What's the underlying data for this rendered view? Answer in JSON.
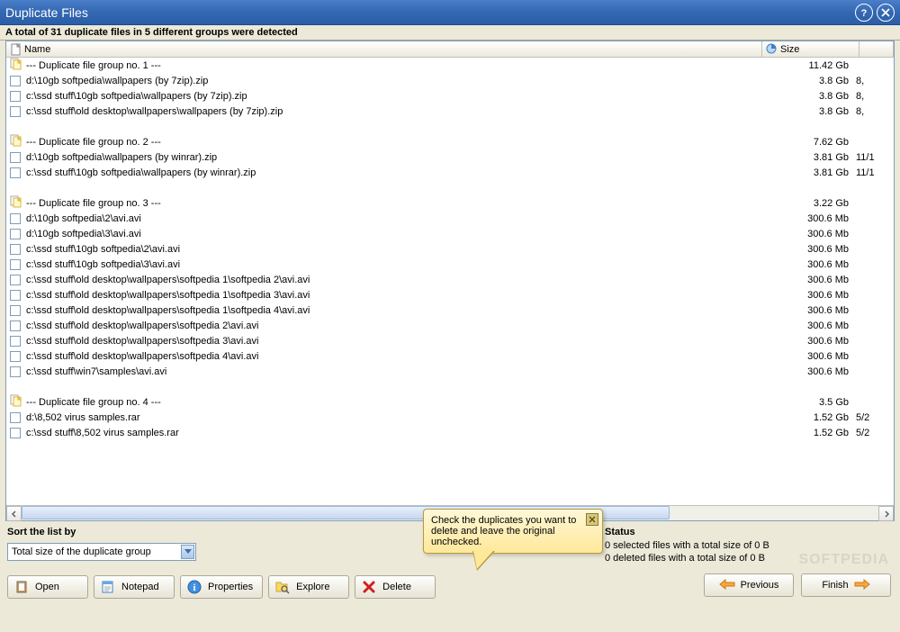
{
  "title": "Duplicate Files",
  "summary": "A total of 31 duplicate files in 5 different groups were detected",
  "columns": {
    "name": "Name",
    "size": "Size"
  },
  "rows": [
    {
      "type": "group",
      "name": "--- Duplicate file group no. 1 ---",
      "size": "11.42 Gb",
      "date": ""
    },
    {
      "type": "file",
      "name": "d:\\10gb softpedia\\wallpapers (by 7zip).zip",
      "size": "3.8 Gb",
      "date": "8,"
    },
    {
      "type": "file",
      "name": "c:\\ssd stuff\\10gb softpedia\\wallpapers (by 7zip).zip",
      "size": "3.8 Gb",
      "date": "8,"
    },
    {
      "type": "file",
      "name": "c:\\ssd stuff\\old desktop\\wallpapers\\wallpapers (by 7zip).zip",
      "size": "3.8 Gb",
      "date": "8,"
    },
    {
      "type": "spacer"
    },
    {
      "type": "group",
      "name": "--- Duplicate file group no. 2 ---",
      "size": "7.62 Gb",
      "date": ""
    },
    {
      "type": "file",
      "name": "d:\\10gb softpedia\\wallpapers (by winrar).zip",
      "size": "3.81 Gb",
      "date": "11/1"
    },
    {
      "type": "file",
      "name": "c:\\ssd stuff\\10gb softpedia\\wallpapers (by winrar).zip",
      "size": "3.81 Gb",
      "date": "11/1"
    },
    {
      "type": "spacer"
    },
    {
      "type": "group",
      "name": "--- Duplicate file group no. 3 ---",
      "size": "3.22 Gb",
      "date": ""
    },
    {
      "type": "file",
      "name": "d:\\10gb softpedia\\2\\avi.avi",
      "size": "300.6 Mb",
      "date": ""
    },
    {
      "type": "file",
      "name": "d:\\10gb softpedia\\3\\avi.avi",
      "size": "300.6 Mb",
      "date": ""
    },
    {
      "type": "file",
      "name": "c:\\ssd stuff\\10gb softpedia\\2\\avi.avi",
      "size": "300.6 Mb",
      "date": ""
    },
    {
      "type": "file",
      "name": "c:\\ssd stuff\\10gb softpedia\\3\\avi.avi",
      "size": "300.6 Mb",
      "date": ""
    },
    {
      "type": "file",
      "name": "c:\\ssd stuff\\old desktop\\wallpapers\\softpedia 1\\softpedia 2\\avi.avi",
      "size": "300.6 Mb",
      "date": ""
    },
    {
      "type": "file",
      "name": "c:\\ssd stuff\\old desktop\\wallpapers\\softpedia 1\\softpedia 3\\avi.avi",
      "size": "300.6 Mb",
      "date": ""
    },
    {
      "type": "file",
      "name": "c:\\ssd stuff\\old desktop\\wallpapers\\softpedia 1\\softpedia 4\\avi.avi",
      "size": "300.6 Mb",
      "date": ""
    },
    {
      "type": "file",
      "name": "c:\\ssd stuff\\old desktop\\wallpapers\\softpedia 2\\avi.avi",
      "size": "300.6 Mb",
      "date": ""
    },
    {
      "type": "file",
      "name": "c:\\ssd stuff\\old desktop\\wallpapers\\softpedia 3\\avi.avi",
      "size": "300.6 Mb",
      "date": ""
    },
    {
      "type": "file",
      "name": "c:\\ssd stuff\\old desktop\\wallpapers\\softpedia 4\\avi.avi",
      "size": "300.6 Mb",
      "date": ""
    },
    {
      "type": "file",
      "name": "c:\\ssd stuff\\win7\\samples\\avi.avi",
      "size": "300.6 Mb",
      "date": ""
    },
    {
      "type": "spacer"
    },
    {
      "type": "group",
      "name": "--- Duplicate file group no. 4 ---",
      "size": "3.5 Gb",
      "date": ""
    },
    {
      "type": "file",
      "name": "d:\\8,502 virus samples.rar",
      "size": "1.52 Gb",
      "date": "5/2"
    },
    {
      "type": "file",
      "name": "c:\\ssd stuff\\8,502 virus samples.rar",
      "size": "1.52 Gb",
      "date": "5/2"
    }
  ],
  "sort": {
    "label": "Sort the list by",
    "selected": "Total size of the duplicate group"
  },
  "status": {
    "label": "Status",
    "line1": "0 selected files with a total size of 0 B",
    "line2": "0 deleted files with a total size of 0 B"
  },
  "tooltip": "Check the duplicates you want to delete and leave the original unchecked.",
  "buttons": {
    "open": "Open",
    "notepad": "Notepad",
    "properties": "Properties",
    "explore": "Explore",
    "delete": "Delete",
    "previous": "Previous",
    "finish": "Finish"
  },
  "watermark": "SOFTPEDIA"
}
